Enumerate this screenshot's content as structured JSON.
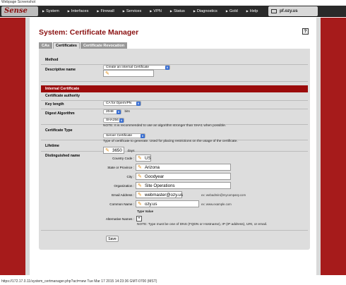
{
  "caption": "Webpage Screenshot",
  "brand": {
    "logo_text": "Sense"
  },
  "nav": {
    "items": [
      {
        "label": "System"
      },
      {
        "label": "Interfaces"
      },
      {
        "label": "Firewall"
      },
      {
        "label": "Services"
      },
      {
        "label": "VPN"
      },
      {
        "label": "Status"
      },
      {
        "label": "Diagnostics"
      },
      {
        "label": "Gold"
      },
      {
        "label": "Help"
      }
    ],
    "hostname": "pf.ozy.us"
  },
  "page": {
    "title": "System: Certificate Manager",
    "help": "?"
  },
  "tabs": [
    {
      "label": "CAs",
      "active": false
    },
    {
      "label": "Certificates",
      "active": true
    },
    {
      "label": "Certificate Revocation",
      "active": false
    }
  ],
  "form": {
    "method": {
      "label": "Method",
      "value": "Create an internal Certificate"
    },
    "descriptive_name": {
      "label": "Descriptive name",
      "value": ""
    },
    "section_title": "Internal Certificate",
    "ca": {
      "label": "Certificate authority",
      "value": "CA for OpenVPN"
    },
    "key_length": {
      "label": "Key length",
      "value": "2048",
      "unit": "bits"
    },
    "digest": {
      "label": "Digest Algorithm",
      "value": "SHA256",
      "note": "NOTE: It is recommended to use an algorithm stronger than SHA1 when possible."
    },
    "cert_type": {
      "label": "Certificate Type",
      "value": "Server Certificate",
      "note": "Type of certificate to generate. Used for placing restrictions on the usage of the certificate."
    },
    "lifetime": {
      "label": "Lifetime",
      "value": "3650",
      "unit": "days"
    },
    "dn": {
      "label": "Distinguished name",
      "country_label": "Country Code :",
      "country_value": "US",
      "state_label": "State or Province :",
      "state_value": "Arizona",
      "city_label": "City :",
      "city_value": "Goodyear",
      "org_label": "Organization :",
      "org_value": "Site Operations",
      "email_label": "Email Address :",
      "email_value": "webmaster@ozy.us",
      "email_example": "ex:   webadmin@mycompany.com",
      "cn_label": "Common Name :",
      "cn_value": "ozy.us",
      "cn_example": "ex:   www.example.com",
      "type_value_header": "Type Value",
      "alt_label": "Alternative Names :",
      "alt_note": "NOTE: Type must be one of DNS (FQDN or Hostname), IP (IP address), URI, or email."
    },
    "save_label": "Save"
  },
  "statusbar": "https://172.17.0.11/system_certmanager.php?act=new Tue Mar 17 2015 14:23:36 GMT-0700 (MST)"
}
